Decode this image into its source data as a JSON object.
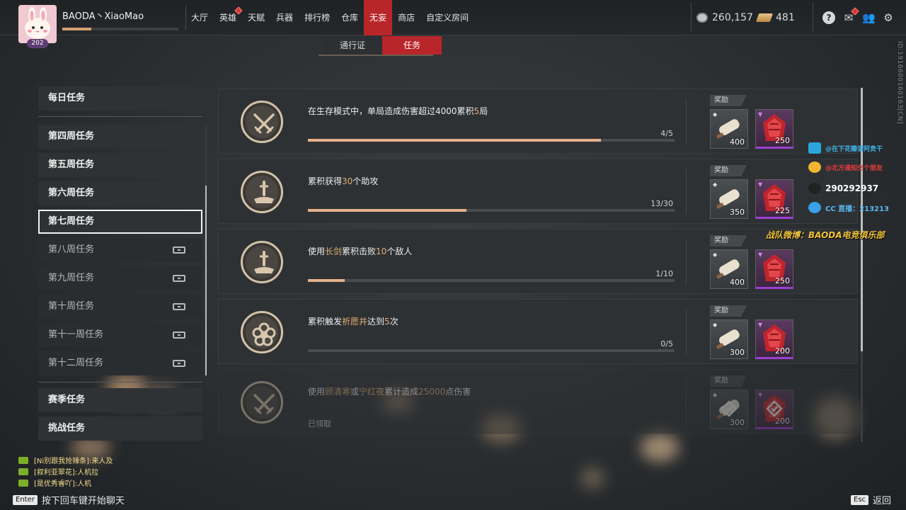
{
  "player": {
    "name": "BAODA丶XiaoMao",
    "level": "202",
    "xp_fraction": 0.25
  },
  "nav": {
    "items": [
      {
        "label": "大厅",
        "active": false,
        "alert": false
      },
      {
        "label": "英雄",
        "active": false,
        "alert": true
      },
      {
        "label": "天赋",
        "active": false,
        "alert": false
      },
      {
        "label": "兵器",
        "active": false,
        "alert": false
      },
      {
        "label": "排行榜",
        "active": false,
        "alert": false
      },
      {
        "label": "仓库",
        "active": false,
        "alert": false
      },
      {
        "label": "无妄",
        "active": true,
        "alert": false
      },
      {
        "label": "商店",
        "active": false,
        "alert": false
      },
      {
        "label": "自定义房间",
        "active": false,
        "alert": false
      }
    ]
  },
  "currency": {
    "coins": "260,157",
    "gold": "481"
  },
  "top_icons": [
    "help-icon",
    "mail-icon",
    "friends-icon",
    "settings-icon"
  ],
  "subtabs": {
    "pass": "通行证",
    "tasks": "任务",
    "active": "tasks"
  },
  "vertical_id": "ID:1916600160163[CN]",
  "sidebar": {
    "daily": "每日任务",
    "weeks": [
      {
        "label": "第四周任务",
        "locked": false,
        "active": false
      },
      {
        "label": "第五周任务",
        "locked": false,
        "active": false
      },
      {
        "label": "第六周任务",
        "locked": false,
        "active": false
      },
      {
        "label": "第七周任务",
        "locked": false,
        "active": true
      },
      {
        "label": "第八周任务",
        "locked": true,
        "active": false
      },
      {
        "label": "第九周任务",
        "locked": true,
        "active": false
      },
      {
        "label": "第十周任务",
        "locked": true,
        "active": false
      },
      {
        "label": "第十一周任务",
        "locked": true,
        "active": false
      },
      {
        "label": "第十二周任务",
        "locked": true,
        "active": false
      }
    ],
    "season": "赛季任务",
    "challenge": "挑战任务"
  },
  "tasks": [
    {
      "emblem": "crossed-swords-icon",
      "desc": [
        {
          "t": "在生存模式中，单局造成伤害超过4000累积"
        },
        {
          "t": "5",
          "hl": true
        },
        {
          "t": "局"
        }
      ],
      "progress": 0.8,
      "count": "4/5",
      "claimed": false,
      "reward_label": "奖励",
      "rewards": [
        {
          "type": "scroll",
          "qty": "400"
        },
        {
          "type": "gem",
          "qty": "250"
        }
      ]
    },
    {
      "emblem": "sword-anvil-icon",
      "desc": [
        {
          "t": "累积获得"
        },
        {
          "t": "30",
          "hl": true
        },
        {
          "t": "个助攻"
        }
      ],
      "progress": 0.4333,
      "count": "13/30",
      "claimed": false,
      "reward_label": "奖励",
      "rewards": [
        {
          "type": "scroll",
          "qty": "350"
        },
        {
          "type": "gem",
          "qty": "225"
        }
      ]
    },
    {
      "emblem": "sword-anvil-icon",
      "desc": [
        {
          "t": "使用"
        },
        {
          "t": "长剑",
          "hl": true
        },
        {
          "t": "累积击败"
        },
        {
          "t": "10",
          "hl": true
        },
        {
          "t": "个敌人"
        }
      ],
      "progress": 0.1,
      "count": "1/10",
      "claimed": false,
      "reward_label": "奖励",
      "rewards": [
        {
          "type": "scroll",
          "qty": "400"
        },
        {
          "type": "gem",
          "qty": "250"
        }
      ]
    },
    {
      "emblem": "flower-icon",
      "desc": [
        {
          "t": "累积触发"
        },
        {
          "t": "祈愿井",
          "hl": true
        },
        {
          "t": "达到"
        },
        {
          "t": "5",
          "hl": true
        },
        {
          "t": "次"
        }
      ],
      "progress": 0,
      "count": "0/5",
      "claimed": false,
      "reward_label": "奖励",
      "rewards": [
        {
          "type": "scroll",
          "qty": "300"
        },
        {
          "type": "gem",
          "qty": "200"
        }
      ]
    },
    {
      "emblem": "crossed-swords-icon",
      "desc": [
        {
          "t": "使用"
        },
        {
          "t": "顾清寒",
          "hl": true
        },
        {
          "t": "或"
        },
        {
          "t": "宁红夜",
          "hl": true
        },
        {
          "t": "累计造成"
        },
        {
          "t": "25000",
          "hl": true
        },
        {
          "t": "点伤害"
        }
      ],
      "progress": 1,
      "count": "",
      "claimed": true,
      "claimed_label": "已领取",
      "reward_label": "奖励",
      "rewards": [
        {
          "type": "scroll",
          "qty": "300"
        },
        {
          "type": "gem",
          "qty": "200"
        }
      ]
    }
  ],
  "overlay": {
    "bilibili": "@在下花瓣请阿贵干",
    "weibo": "@北方通知交个朋友",
    "qq": "290292937",
    "cc": "CC 直播：213213",
    "team_weibo": "战队微博：BAODA电竞俱乐部"
  },
  "chat": {
    "lines": [
      "[Ni别跟我抢辣条]:来人及",
      "[叙利亚翠花]:人机拉",
      "[是优秀睿吖]:人机"
    ],
    "enter_key": "Enter",
    "enter_hint": "按下回车键开始聊天",
    "esc_key": "Esc",
    "back_label": "返回"
  },
  "colors": {
    "accent_red": "#b8262a",
    "highlight": "#e0ae72",
    "progress": "#e3b08a",
    "gem_purple": "#9c3fd2"
  }
}
